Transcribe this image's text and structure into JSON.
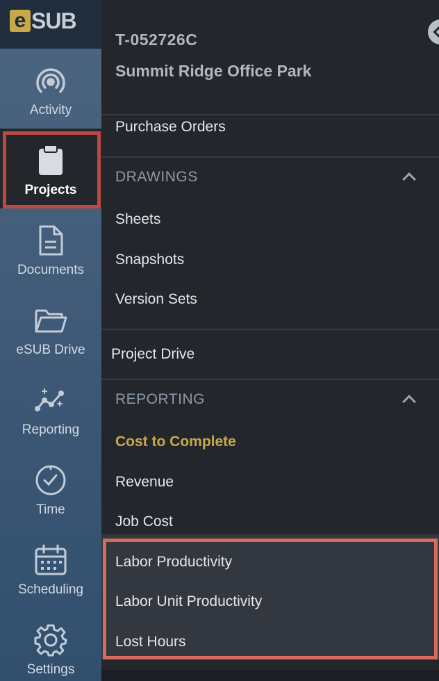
{
  "brand": {
    "logo_letter": "e",
    "logo_text": "SUB",
    "accent": "#c9a84a"
  },
  "rail": {
    "items": [
      {
        "label": "Activity",
        "icon": "activity-icon"
      },
      {
        "label": "Projects",
        "icon": "clipboard-icon",
        "active": true
      },
      {
        "label": "Documents",
        "icon": "document-icon"
      },
      {
        "label": "eSUB Drive",
        "icon": "folder-icon"
      },
      {
        "label": "Reporting",
        "icon": "reporting-icon"
      },
      {
        "label": "Time",
        "icon": "clock-icon"
      },
      {
        "label": "Scheduling",
        "icon": "calendar-icon"
      },
      {
        "label": "Settings",
        "icon": "gear-icon"
      }
    ]
  },
  "project": {
    "id": "T-052726C",
    "name": "Summit Ridge Office Park"
  },
  "menu": {
    "purchase_orders": "Purchase Orders",
    "drawings": {
      "heading": "DRAWINGS",
      "items": [
        "Sheets",
        "Snapshots",
        "Version Sets"
      ]
    },
    "project_drive": "Project Drive",
    "reporting": {
      "heading": "REPORTING",
      "items": [
        "Cost to Complete",
        "Revenue",
        "Job Cost"
      ],
      "sub_items": [
        "Labor Productivity",
        "Labor Unit Productivity",
        "Lost Hours"
      ]
    }
  },
  "colors": {
    "rail_top": "#4d6682",
    "panel_bg": "#23272c",
    "current_item": "#c9a84a",
    "active_outline": "#b84a42",
    "highlight_outline": "#d96b5c"
  }
}
